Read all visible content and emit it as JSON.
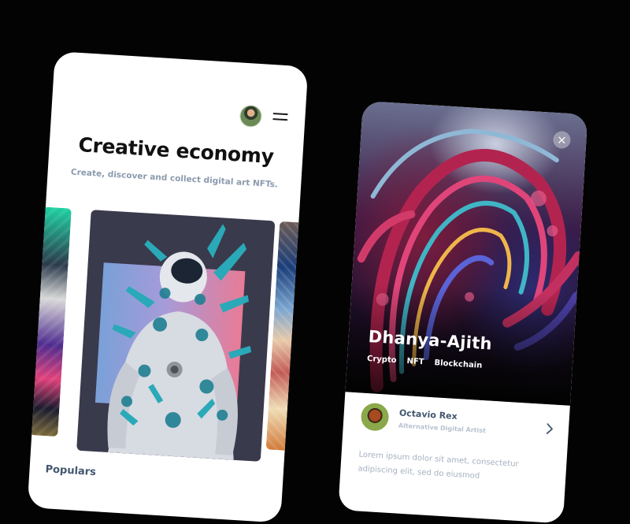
{
  "left_screen": {
    "title": "Creative economy",
    "subtitle": "Create, discover and collect digital art NFTs.",
    "section_heading": "Populars",
    "icons": {
      "avatar": "user-avatar",
      "menu": "hamburger-menu-icon"
    }
  },
  "right_screen": {
    "artist_name": "Dhanya-Ajith",
    "tags": [
      "Crypto",
      "NFT",
      "Blockchain"
    ],
    "close_symbol": "×",
    "creator": {
      "name": "Octavio Rex",
      "role": "Alternative Digital Artist"
    },
    "description": "Lorem ipsum dolor sit amet, consectetur adipiscing elit, sed do eiusmod",
    "icons": {
      "close": "close-icon",
      "chevron": "chevron-right-icon"
    }
  },
  "colors": {
    "background": "#030303",
    "heading": "#111111",
    "muted_text": "#8b9aae",
    "accent_text": "#42566e"
  }
}
